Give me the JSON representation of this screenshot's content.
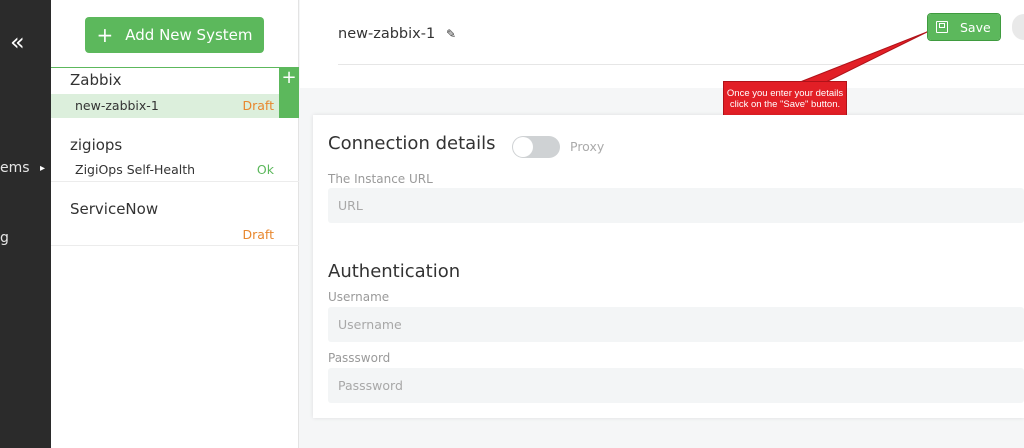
{
  "nav": {
    "collapse_glyph": "«",
    "partial_label_1": "ems",
    "partial_label_2": "g",
    "chevron_glyph": "▸"
  },
  "systems": {
    "add_label": "Add New System",
    "groups": [
      {
        "name": "Zabbix",
        "instances": [
          {
            "name": "new-zabbix-1",
            "status": "Draft"
          }
        ]
      },
      {
        "name": "zigiops",
        "instances": [
          {
            "name": "ZigiOps Self-Health",
            "status": "Ok"
          }
        ]
      },
      {
        "name": "ServiceNow",
        "instances": [
          {
            "name": "",
            "status": "Draft"
          }
        ]
      }
    ]
  },
  "header": {
    "system_name": "new-zabbix-1",
    "save_label": "Save"
  },
  "callout": {
    "text": "Once you enter your details click on the \"Save\" button."
  },
  "form": {
    "connection_title": "Connection details",
    "proxy_label": "Proxy",
    "proxy_on": false,
    "url_label": "The Instance URL",
    "url_placeholder": "URL",
    "auth_title": "Authentication",
    "username_label": "Username",
    "username_placeholder": "Username",
    "password_label": "Passsword",
    "password_placeholder": "Passsword"
  },
  "colors": {
    "accent_green": "#5cb85c",
    "draft_orange": "#e8872e",
    "callout_red": "#e21f26",
    "nav_dark": "#2b2b2b"
  }
}
